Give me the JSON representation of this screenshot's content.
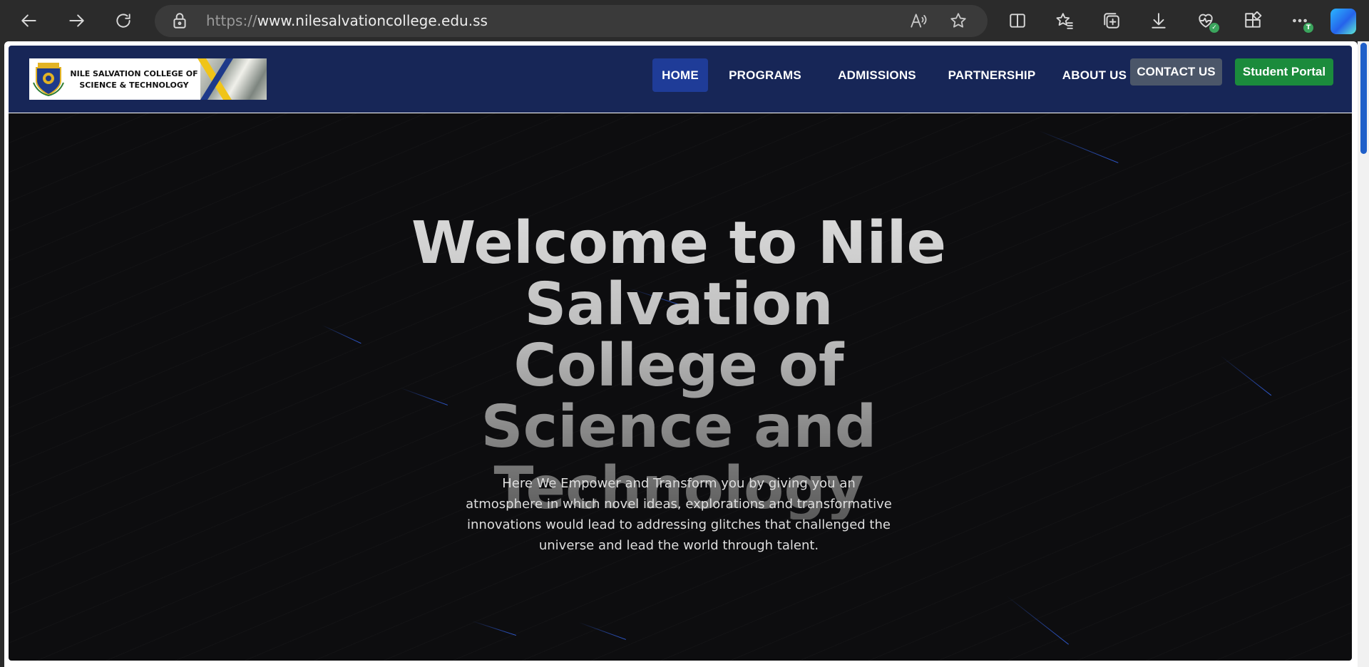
{
  "browser": {
    "url_scheme": "https://",
    "url_host": "www.nilesalvationcollege.edu.ss",
    "profile_badge": "T"
  },
  "site": {
    "logo_text": "NILE SALVATION COLLEGE OF SCIENCE & TECHNOLOGY",
    "nav": {
      "home": "HOME",
      "programs": "PROGRAMS",
      "admissions": "ADMISSIONS",
      "partnership": "PARTNERSHIP",
      "about": "ABOUT US",
      "contact": "CONTACT US",
      "portal": "Student Portal"
    },
    "hero": {
      "title": "Welcome to Nile Salvation College of Science and Technology",
      "subtitle": "Here We Empower and Transform you by giving you an atmosphere in which novel ideas, explorations and transformative innovations would lead to addressing glitches that challenged the universe and lead the world through talent."
    }
  },
  "colors": {
    "nav_bg": "#172657",
    "nav_active": "#1f3c98",
    "contact_bg": "#4b5669",
    "portal_bg": "#1b8b3c",
    "hero_bg": "#0d0d0f",
    "streak": "#2f5bd6"
  },
  "icons": {
    "back": "arrow-left-icon",
    "forward": "arrow-right-icon",
    "refresh": "refresh-icon",
    "lock": "lock-icon",
    "read_aloud": "read-aloud-icon",
    "favorite": "star-icon",
    "split": "split-screen-icon",
    "favorites": "favorites-icon",
    "collections": "collections-icon",
    "downloads": "download-icon",
    "health": "browser-essentials-icon",
    "extensions": "extensions-icon",
    "more": "more-icon",
    "copilot": "copilot-icon"
  }
}
